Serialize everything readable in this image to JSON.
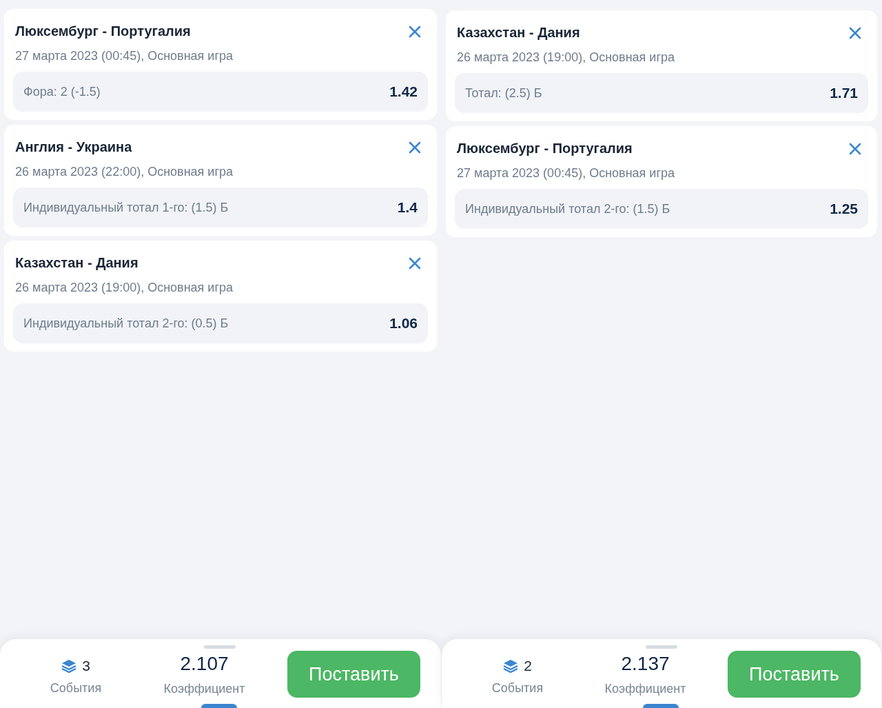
{
  "panels": [
    {
      "bets": [
        {
          "match": "Люксембург - Португалия",
          "date": "27 марта 2023 (00:45), Основная игра",
          "market": "Фора: 2 (-1.5)",
          "odds": "1.42"
        },
        {
          "match": "Англия - Украина",
          "date": "26 марта 2023 (22:00), Основная игра",
          "market": "Индивидуальный тотал 1-го: (1.5) Б",
          "odds": "1.4"
        },
        {
          "match": "Казахстан - Дания",
          "date": "26 марта 2023 (19:00), Основная игра",
          "market": "Индивидуальный тотал 2-го: (0.5) Б",
          "odds": "1.06"
        }
      ],
      "summary": {
        "events_count": "3",
        "events_label": "События",
        "coefficient": "2.107",
        "coefficient_label": "Коэффициент",
        "button": "Поставить"
      }
    },
    {
      "bets": [
        {
          "match": "Казахстан - Дания",
          "date": "26 марта 2023 (19:00), Основная игра",
          "market": "Тотал: (2.5) Б",
          "odds": "1.71"
        },
        {
          "match": "Люксембург - Португалия",
          "date": "27 марта 2023 (00:45), Основная игра",
          "market": "Индивидуальный тотал 2-го: (1.5) Б",
          "odds": "1.25"
        }
      ],
      "summary": {
        "events_count": "2",
        "events_label": "События",
        "coefficient": "2.137",
        "coefficient_label": "Коэффициент",
        "button": "Поставить"
      }
    }
  ]
}
